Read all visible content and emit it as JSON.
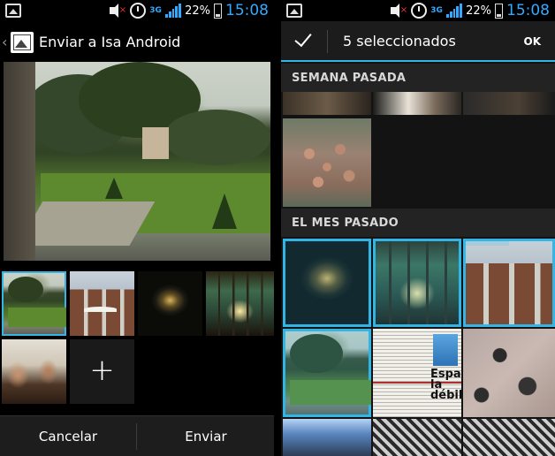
{
  "status_bar": {
    "network": "3G",
    "battery_pct": "22%",
    "time": "15:08"
  },
  "left_screen": {
    "title": "Enviar a Isa Android",
    "add_symbol": "+",
    "buttons": {
      "cancel": "Cancelar",
      "send": "Enviar"
    }
  },
  "right_screen": {
    "selection_count": "5 seleccionados",
    "ok": "OK",
    "sections": {
      "last_week": "SEMANA PASADA",
      "last_month": "EL MES PASADO"
    },
    "newspaper_headline": "España la débil"
  },
  "colors": {
    "accent": "#33b5e5",
    "status_blue": "#33aaff",
    "bottom_bar": "#1d1d1d"
  },
  "icons": [
    "gallery-icon",
    "volume-icon",
    "alarm-icon",
    "signal-icon",
    "battery-icon",
    "check-icon",
    "plus-icon"
  ]
}
